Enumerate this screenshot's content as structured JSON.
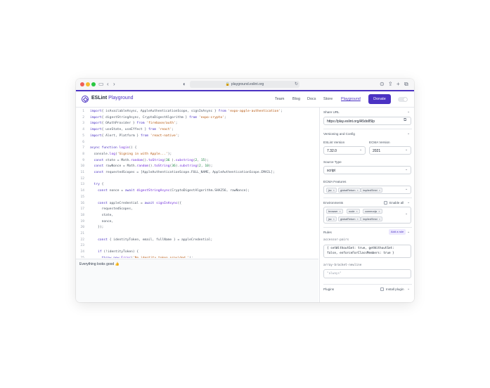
{
  "browser": {
    "url": "playground.eslint.org",
    "dots": [
      "#ef5f57",
      "#f6bd2f",
      "#28c840"
    ]
  },
  "header": {
    "brand": "ESLint",
    "brand_suffix": "Playground",
    "nav": [
      "Team",
      "Blog",
      "Docs",
      "Store",
      "Playground"
    ],
    "active_nav": "Playground",
    "donate_label": "Donate",
    "accent_color": "#4b32c3"
  },
  "editor": {
    "lines": [
      {
        "n": "1",
        "segs": [
          [
            "kw",
            "import"
          ],
          [
            "",
            "{ isAvailableAsync, AppleAuthenticationScope, signInAsync } "
          ],
          [
            "kw",
            "from"
          ],
          [
            "",
            " "
          ],
          [
            "str",
            "'expo-apple-authentication'"
          ],
          [
            "",
            ";"
          ]
        ]
      },
      {
        "n": "2",
        "segs": [
          [
            "kw",
            "import"
          ],
          [
            "",
            "{ digestStringAsync, CryptoDigestAlgorithm } "
          ],
          [
            "kw",
            "from"
          ],
          [
            "",
            " "
          ],
          [
            "str",
            "'expo-crypto'"
          ],
          [
            "",
            ";"
          ]
        ]
      },
      {
        "n": "3",
        "segs": [
          [
            "kw",
            "import"
          ],
          [
            "",
            "{ OAuthProvider } "
          ],
          [
            "kw",
            "from"
          ],
          [
            "",
            " "
          ],
          [
            "str",
            "'firebase/auth'"
          ],
          [
            "",
            ";"
          ]
        ]
      },
      {
        "n": "4",
        "segs": [
          [
            "kw",
            "import"
          ],
          [
            "",
            "{ useState, useEffect } "
          ],
          [
            "kw",
            "from"
          ],
          [
            "",
            " "
          ],
          [
            "str",
            "'react'"
          ],
          [
            "",
            ";"
          ]
        ]
      },
      {
        "n": "5",
        "segs": [
          [
            "kw",
            "import"
          ],
          [
            "",
            "{ Alert, Platform } "
          ],
          [
            "kw",
            "from"
          ],
          [
            "",
            " "
          ],
          [
            "str",
            "'react-native'"
          ],
          [
            "",
            ";"
          ]
        ]
      },
      {
        "n": "6",
        "segs": []
      },
      {
        "n": "7",
        "segs": [
          [
            "kw",
            "async function"
          ],
          [
            "",
            " "
          ],
          [
            "fn",
            "login"
          ],
          [
            "",
            "() {"
          ]
        ]
      },
      {
        "n": "8",
        "segs": [
          [
            "",
            "  console."
          ],
          [
            "fn",
            "log"
          ],
          [
            "",
            "("
          ],
          [
            "str",
            "'Signing in with Apple...'"
          ],
          [
            "",
            ");"
          ]
        ]
      },
      {
        "n": "9",
        "segs": [
          [
            "",
            "  "
          ],
          [
            "kw",
            "const"
          ],
          [
            "",
            " state = Math."
          ],
          [
            "fn",
            "random"
          ],
          [
            "",
            "()."
          ],
          [
            "fn",
            "toString"
          ],
          [
            "",
            "("
          ],
          [
            "num",
            "36"
          ],
          [
            "",
            " )."
          ],
          [
            "fn",
            "substring"
          ],
          [
            "",
            "("
          ],
          [
            "num",
            "2"
          ],
          [
            "",
            ", "
          ],
          [
            "num",
            "15"
          ],
          [
            "",
            ");"
          ]
        ]
      },
      {
        "n": "10",
        "segs": [
          [
            "",
            "  "
          ],
          [
            "kw",
            "const"
          ],
          [
            "",
            " rawNonce = Math."
          ],
          [
            "fn",
            "random"
          ],
          [
            "",
            "()."
          ],
          [
            "fn",
            "toString"
          ],
          [
            "",
            "("
          ],
          [
            "num",
            "36"
          ],
          [
            "",
            ")."
          ],
          [
            "fn",
            "substring"
          ],
          [
            "",
            "("
          ],
          [
            "num",
            "2"
          ],
          [
            "",
            ", "
          ],
          [
            "num",
            "10"
          ],
          [
            "",
            ");"
          ]
        ]
      },
      {
        "n": "11",
        "segs": [
          [
            "",
            "  "
          ],
          [
            "kw",
            "const"
          ],
          [
            "",
            " requestedScopes = [AppleAuthenticationScope.FULL_NAME, AppleAuthenticationScope.EMAIL];"
          ]
        ]
      },
      {
        "n": "12",
        "segs": []
      },
      {
        "n": "13",
        "segs": [
          [
            "",
            "  "
          ],
          [
            "kw",
            "try"
          ],
          [
            "",
            " {"
          ]
        ]
      },
      {
        "n": "14",
        "segs": [
          [
            "",
            "    "
          ],
          [
            "kw",
            "const"
          ],
          [
            "",
            " nonce = "
          ],
          [
            "kw",
            "await"
          ],
          [
            "",
            " "
          ],
          [
            "fn",
            "digestStringAsync"
          ],
          [
            "",
            "(CryptoDigestAlgorithm.SHA256, rawNonce);"
          ]
        ]
      },
      {
        "n": "15",
        "segs": []
      },
      {
        "n": "16",
        "segs": [
          [
            "",
            "    "
          ],
          [
            "kw",
            "const"
          ],
          [
            "",
            " appleCredential = "
          ],
          [
            "kw",
            "await"
          ],
          [
            "",
            " "
          ],
          [
            "fn",
            "signInAsync"
          ],
          [
            "",
            "({"
          ]
        ]
      },
      {
        "n": "17",
        "segs": [
          [
            "",
            "      requestedScopes,"
          ]
        ]
      },
      {
        "n": "18",
        "segs": [
          [
            "",
            "      state,"
          ]
        ]
      },
      {
        "n": "19",
        "segs": [
          [
            "",
            "      nonce,"
          ]
        ]
      },
      {
        "n": "20",
        "segs": [
          [
            "",
            "    });"
          ]
        ]
      },
      {
        "n": "21",
        "segs": []
      },
      {
        "n": "22",
        "segs": [
          [
            "",
            "    "
          ],
          [
            "kw",
            "const"
          ],
          [
            "",
            " { identityToken, email, fullName } = appleCredential;"
          ]
        ]
      },
      {
        "n": "23",
        "segs": []
      },
      {
        "n": "24",
        "segs": [
          [
            "",
            "    "
          ],
          [
            "kw",
            "if"
          ],
          [
            "",
            " (!identityToken) {"
          ]
        ]
      },
      {
        "n": "25",
        "segs": [
          [
            "",
            "      "
          ],
          [
            "kw",
            "throw new"
          ],
          [
            "",
            " "
          ],
          [
            "fn",
            "Error"
          ],
          [
            "",
            "("
          ],
          [
            "str",
            "'No identity token provided.'"
          ],
          [
            "",
            ");"
          ]
        ]
      },
      {
        "n": "26",
        "segs": [
          [
            "",
            "    }"
          ]
        ]
      }
    ]
  },
  "output": {
    "message": "Everything looks good 👍"
  },
  "panel": {
    "share_url_label": "Share URL",
    "share_url": "https://play.eslint.org/A5do85lp",
    "versioning_label": "Versioning and Config",
    "eslint_version_label": "ESLint Version",
    "eslint_version": "7.32.0",
    "ecma_version_label": "ECMA Version",
    "ecma_version": "2021",
    "source_type_label": "Source Type",
    "source_type": "script",
    "ecma_features_label": "ECMA Features",
    "ecma_features": [
      "jsx",
      "globalReturn",
      "impliedStrict"
    ],
    "environments_label": "Environments",
    "enable_all_label": "Enable all",
    "environments": [
      "browser",
      "node",
      "commonjs",
      "jsx",
      "globalReturn",
      "impliedStrict"
    ],
    "rules_label": "Rules",
    "add_rule_label": "Add a rule",
    "rule1_name": "accessor-pairs",
    "rule1_code": [
      "{ setWithoutGet: true, getWithoutSet:",
      "false, enforceForClassMembers: true }"
    ],
    "rule2_name": "array-bracket-newline",
    "rule2_value": "\"always\"",
    "plugins_label": "Plugins",
    "install_plugin_label": "Install plugin"
  }
}
